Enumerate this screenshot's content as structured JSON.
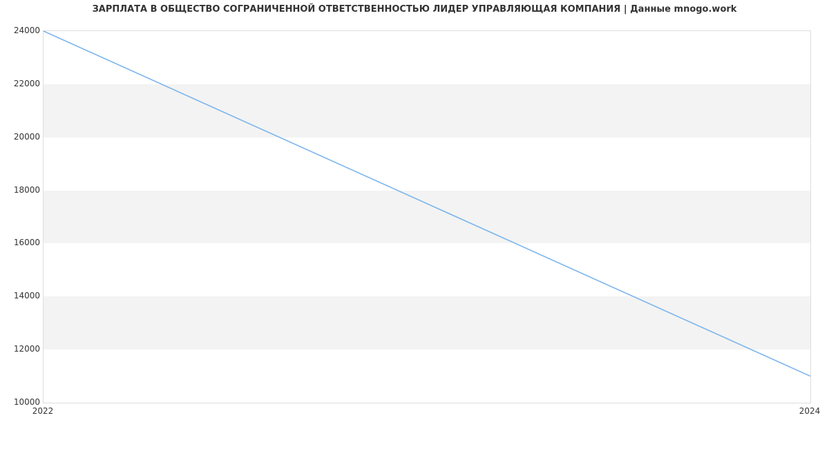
{
  "chart_data": {
    "type": "line",
    "title": "ЗАРПЛАТА В ОБЩЕСТВО СОГРАНИЧЕННОЙ ОТВЕТСТВЕННОСТЬЮ ЛИДЕР УПРАВЛЯЮЩАЯ КОМПАНИЯ | Данные mnogo.work",
    "x": [
      2022,
      2024
    ],
    "values": [
      24000,
      11000
    ],
    "x_ticks": [
      2022,
      2024
    ],
    "y_ticks": [
      10000,
      12000,
      14000,
      16000,
      18000,
      20000,
      22000,
      24000
    ],
    "xlim": [
      2022,
      2024
    ],
    "ylim": [
      10000,
      24000
    ],
    "xlabel": "",
    "ylabel": "",
    "line_color": "#7cb5ec",
    "band_color": "#f3f3f3"
  }
}
